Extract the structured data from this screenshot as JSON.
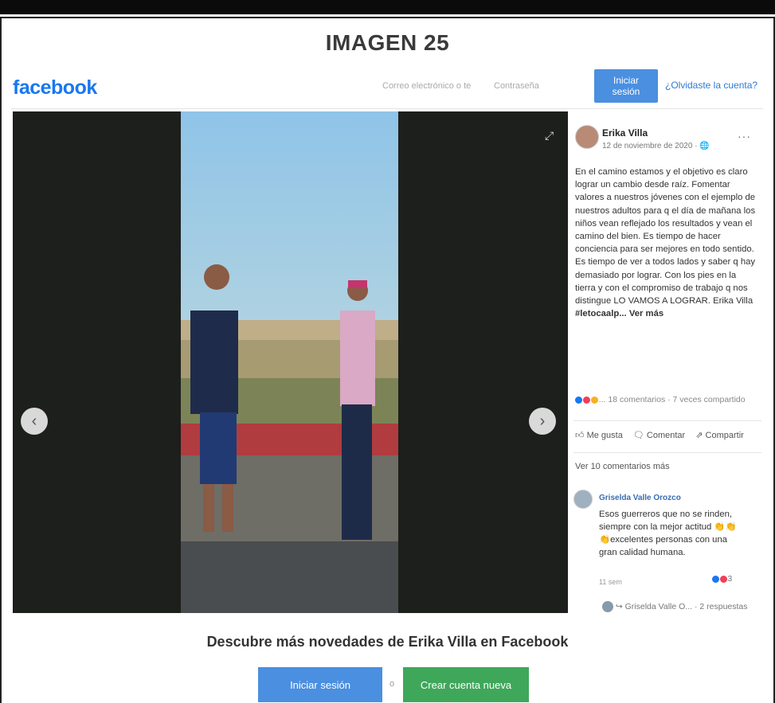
{
  "document": {
    "title": "IMAGEN 25"
  },
  "header": {
    "logo": "facebook",
    "email_placeholder": "Correo electrónico o te",
    "password_placeholder": "Contraseña",
    "login_label": "Iniciar sesión",
    "forgot_label": "¿Olvidaste la cuenta?"
  },
  "viewer": {
    "prev_label": "‹",
    "next_label": "›",
    "expand_label": "⤢"
  },
  "post": {
    "author": "Erika Villa",
    "date": "12 de noviembre de 2020 · ",
    "globe": "🌐",
    "more": "···",
    "text": "En el camino estamos y el objetivo es claro lograr un cambio desde raíz. Fomentar valores a nuestros jóvenes con el ejemplo de nuestros adultos para q el día de mañana los niños vean reflejado los resultados y vean el camino del bien. Es tiempo de hacer conciencia para ser mejores en todo sentido. Es tiempo de ver a todos lados y saber q hay demasiado por lograr. Con los pies en la tierra y con el compromiso de trabajo q nos distingue LO VAMOS A LOGRAR. Erika Villa ",
    "hashtag": "#letocaalp",
    "see_more": "... Ver más",
    "stats": "... 18 comentarios · 7 veces compartido",
    "like": "Me gusta",
    "comment": "Comentar",
    "share": "Compartir",
    "more_comments": "Ver 10 comentarios más"
  },
  "comment": {
    "name": "Griselda Valle Orozco",
    "text": "Esos guerreros que no se rinden, siempre con la mejor actitud 👏👏👏excelentes personas con una gran calidad humana.",
    "time": "11 sem",
    "reactions": "3",
    "reply": "↪ Griselda Valle O... · 2 respuestas"
  },
  "footer": {
    "discover": "Descubre más novedades de Erika Villa en Facebook",
    "login_label": "Iniciar sesión",
    "or": "o",
    "create_label": "Crear cuenta nueva"
  },
  "colors": {
    "brand": "#1877f2",
    "login_button": "#4a8fe0",
    "create_button": "#3fa75a"
  }
}
